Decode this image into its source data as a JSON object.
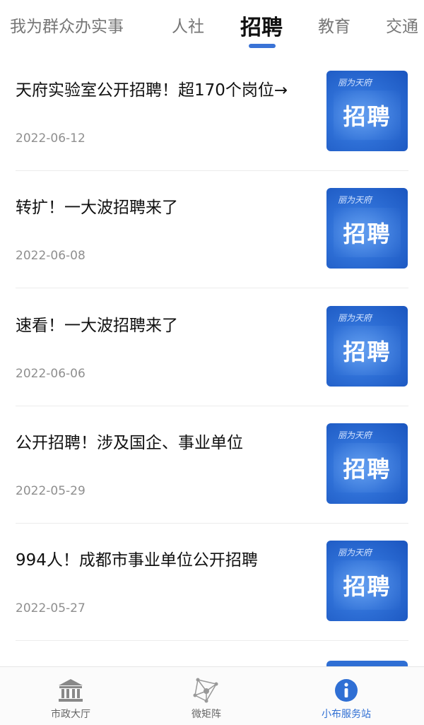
{
  "tabs": [
    {
      "label": "我为群众办实事"
    },
    {
      "label": "人社"
    },
    {
      "label": "招聘"
    },
    {
      "label": "教育"
    },
    {
      "label": "交通"
    }
  ],
  "active_tab": "招聘",
  "articles": [
    {
      "title": "天府实验室公开招聘！超170个岗位→",
      "date": "2022-06-12",
      "thumb_small": "丽为天府",
      "thumb_big": "招聘"
    },
    {
      "title": "转扩！一大波招聘来了",
      "date": "2022-06-08",
      "thumb_small": "丽为天府",
      "thumb_big": "招聘"
    },
    {
      "title": "速看！一大波招聘来了",
      "date": "2022-06-06",
      "thumb_small": "丽为天府",
      "thumb_big": "招聘"
    },
    {
      "title": "公开招聘！涉及国企、事业单位",
      "date": "2022-05-29",
      "thumb_small": "丽为天府",
      "thumb_big": "招聘"
    },
    {
      "title": "994人！成都市事业单位公开招聘",
      "date": "2022-05-27",
      "thumb_small": "丽为天府",
      "thumb_big": "招聘"
    }
  ],
  "bottom_nav": [
    {
      "label": "市政大厅",
      "icon": "government-building-icon"
    },
    {
      "label": "微矩阵",
      "icon": "network-icon"
    },
    {
      "label": "小布服务站",
      "icon": "info-icon"
    }
  ],
  "colors": {
    "accent": "#2f6fd4",
    "tab_underline": "#3a73d6"
  }
}
